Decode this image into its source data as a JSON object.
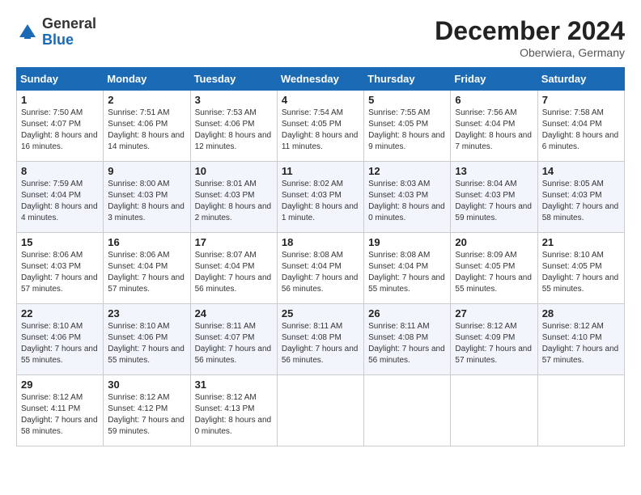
{
  "header": {
    "logo_general": "General",
    "logo_blue": "Blue",
    "month_title": "December 2024",
    "location": "Oberwiera, Germany"
  },
  "days_of_week": [
    "Sunday",
    "Monday",
    "Tuesday",
    "Wednesday",
    "Thursday",
    "Friday",
    "Saturday"
  ],
  "weeks": [
    [
      {
        "day": 1,
        "sunrise": "7:50 AM",
        "sunset": "4:07 PM",
        "daylight": "8 hours and 16 minutes."
      },
      {
        "day": 2,
        "sunrise": "7:51 AM",
        "sunset": "4:06 PM",
        "daylight": "8 hours and 14 minutes."
      },
      {
        "day": 3,
        "sunrise": "7:53 AM",
        "sunset": "4:06 PM",
        "daylight": "8 hours and 12 minutes."
      },
      {
        "day": 4,
        "sunrise": "7:54 AM",
        "sunset": "4:05 PM",
        "daylight": "8 hours and 11 minutes."
      },
      {
        "day": 5,
        "sunrise": "7:55 AM",
        "sunset": "4:05 PM",
        "daylight": "8 hours and 9 minutes."
      },
      {
        "day": 6,
        "sunrise": "7:56 AM",
        "sunset": "4:04 PM",
        "daylight": "8 hours and 7 minutes."
      },
      {
        "day": 7,
        "sunrise": "7:58 AM",
        "sunset": "4:04 PM",
        "daylight": "8 hours and 6 minutes."
      }
    ],
    [
      {
        "day": 8,
        "sunrise": "7:59 AM",
        "sunset": "4:04 PM",
        "daylight": "8 hours and 4 minutes."
      },
      {
        "day": 9,
        "sunrise": "8:00 AM",
        "sunset": "4:03 PM",
        "daylight": "8 hours and 3 minutes."
      },
      {
        "day": 10,
        "sunrise": "8:01 AM",
        "sunset": "4:03 PM",
        "daylight": "8 hours and 2 minutes."
      },
      {
        "day": 11,
        "sunrise": "8:02 AM",
        "sunset": "4:03 PM",
        "daylight": "8 hours and 1 minute."
      },
      {
        "day": 12,
        "sunrise": "8:03 AM",
        "sunset": "4:03 PM",
        "daylight": "8 hours and 0 minutes."
      },
      {
        "day": 13,
        "sunrise": "8:04 AM",
        "sunset": "4:03 PM",
        "daylight": "7 hours and 59 minutes."
      },
      {
        "day": 14,
        "sunrise": "8:05 AM",
        "sunset": "4:03 PM",
        "daylight": "7 hours and 58 minutes."
      }
    ],
    [
      {
        "day": 15,
        "sunrise": "8:06 AM",
        "sunset": "4:03 PM",
        "daylight": "7 hours and 57 minutes."
      },
      {
        "day": 16,
        "sunrise": "8:06 AM",
        "sunset": "4:04 PM",
        "daylight": "7 hours and 57 minutes."
      },
      {
        "day": 17,
        "sunrise": "8:07 AM",
        "sunset": "4:04 PM",
        "daylight": "7 hours and 56 minutes."
      },
      {
        "day": 18,
        "sunrise": "8:08 AM",
        "sunset": "4:04 PM",
        "daylight": "7 hours and 56 minutes."
      },
      {
        "day": 19,
        "sunrise": "8:08 AM",
        "sunset": "4:04 PM",
        "daylight": "7 hours and 55 minutes."
      },
      {
        "day": 20,
        "sunrise": "8:09 AM",
        "sunset": "4:05 PM",
        "daylight": "7 hours and 55 minutes."
      },
      {
        "day": 21,
        "sunrise": "8:10 AM",
        "sunset": "4:05 PM",
        "daylight": "7 hours and 55 minutes."
      }
    ],
    [
      {
        "day": 22,
        "sunrise": "8:10 AM",
        "sunset": "4:06 PM",
        "daylight": "7 hours and 55 minutes."
      },
      {
        "day": 23,
        "sunrise": "8:10 AM",
        "sunset": "4:06 PM",
        "daylight": "7 hours and 55 minutes."
      },
      {
        "day": 24,
        "sunrise": "8:11 AM",
        "sunset": "4:07 PM",
        "daylight": "7 hours and 56 minutes."
      },
      {
        "day": 25,
        "sunrise": "8:11 AM",
        "sunset": "4:08 PM",
        "daylight": "7 hours and 56 minutes."
      },
      {
        "day": 26,
        "sunrise": "8:11 AM",
        "sunset": "4:08 PM",
        "daylight": "7 hours and 56 minutes."
      },
      {
        "day": 27,
        "sunrise": "8:12 AM",
        "sunset": "4:09 PM",
        "daylight": "7 hours and 57 minutes."
      },
      {
        "day": 28,
        "sunrise": "8:12 AM",
        "sunset": "4:10 PM",
        "daylight": "7 hours and 57 minutes."
      }
    ],
    [
      {
        "day": 29,
        "sunrise": "8:12 AM",
        "sunset": "4:11 PM",
        "daylight": "7 hours and 58 minutes."
      },
      {
        "day": 30,
        "sunrise": "8:12 AM",
        "sunset": "4:12 PM",
        "daylight": "7 hours and 59 minutes."
      },
      {
        "day": 31,
        "sunrise": "8:12 AM",
        "sunset": "4:13 PM",
        "daylight": "8 hours and 0 minutes."
      },
      null,
      null,
      null,
      null
    ]
  ]
}
